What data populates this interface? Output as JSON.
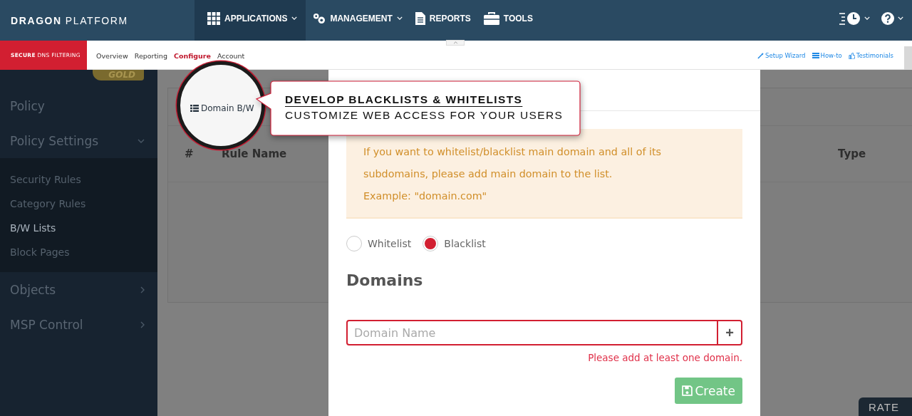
{
  "topbar": {
    "brand_bold": "DRAGON",
    "brand_light": "PLATFORM",
    "nav": [
      {
        "label": "APPLICATIONS",
        "dropdown": true,
        "selected": true
      },
      {
        "label": "MANAGEMENT",
        "dropdown": true,
        "selected": false
      },
      {
        "label": "REPORTS",
        "dropdown": false,
        "selected": false
      },
      {
        "label": "TOOLS",
        "dropdown": false,
        "selected": false
      }
    ]
  },
  "subbar": {
    "product": "**SECURE** DNS FILTERING",
    "links": [
      {
        "label": "Overview",
        "selected": false
      },
      {
        "label": "Reporting",
        "selected": false
      },
      {
        "label": "Configure",
        "selected": true
      },
      {
        "label": "Account",
        "selected": false
      }
    ],
    "help_links": [
      "Setup Wizard",
      "How-to",
      "Testimonials"
    ]
  },
  "sidebar": {
    "badge": "GOLD",
    "items": [
      {
        "label": "Policy"
      },
      {
        "label": "Policy Settings",
        "expanded": true,
        "children": [
          {
            "label": "Security Rules",
            "selected": false
          },
          {
            "label": "Category Rules",
            "selected": false
          },
          {
            "label": "B/W Lists",
            "selected": true
          },
          {
            "label": "Block Pages",
            "selected": false
          }
        ]
      },
      {
        "label": "Objects",
        "expanded": false
      },
      {
        "label": "MSP Control",
        "expanded": false
      }
    ]
  },
  "table": {
    "columns": [
      "#",
      "Rule Name",
      "Type"
    ]
  },
  "magnifier": {
    "tab": "Domain B/W"
  },
  "callout": {
    "title": "DEVELOP BLACKLISTS & WHITELISTS",
    "subtitle": "CUSTOMIZE WEB ACCESS FOR YOUR USERS"
  },
  "modal": {
    "alert": [
      "If you want to whitelist/blacklist main domain and all of its subdomains, please add main domain to the list.",
      "Example: \"domain.com\""
    ],
    "list_types": [
      {
        "label": "Whitelist",
        "selected": false
      },
      {
        "label": "Blacklist",
        "selected": true
      }
    ],
    "heading": "Domains",
    "domain_field": {
      "placeholder": "Domain Name",
      "invalid": true
    },
    "add_button": "+",
    "error": "Please add at least one domain.",
    "create_button": "Create"
  },
  "rate_tab": "RATE"
}
